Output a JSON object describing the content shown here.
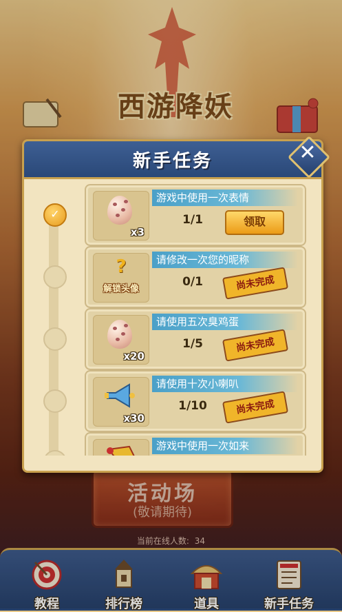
{
  "header_logo": "西游降妖",
  "modal": {
    "title": "新手任务",
    "close_label": "✕"
  },
  "tasks": [
    {
      "name": "游戏中使用一次表情",
      "progress": "1/1",
      "reward_icon": "egg-icon",
      "reward_qty": "x3",
      "status": "领取",
      "state": "claimable"
    },
    {
      "name": "请修改一次您的昵称",
      "progress": "0/1",
      "reward_icon": "unlock-avatar-icon",
      "reward_label": "解锁头像",
      "status": "尚未完成",
      "state": "incomplete"
    },
    {
      "name": "请使用五次臭鸡蛋",
      "progress": "1/5",
      "reward_icon": "egg-icon",
      "reward_qty": "x20",
      "status": "尚未完成",
      "state": "incomplete"
    },
    {
      "name": "请使用十次小喇叭",
      "progress": "1/10",
      "reward_icon": "horn-icon",
      "reward_qty": "x30",
      "status": "尚未完成",
      "state": "incomplete"
    },
    {
      "name": "游戏中使用一次如来",
      "reward_icon": "flag-icon"
    }
  ],
  "activity": {
    "title": "活动场",
    "subtitle": "(敬请期待)"
  },
  "online": {
    "label": "当前在线人数:",
    "count": "34"
  },
  "bottom_nav": [
    {
      "label": "教程",
      "icon": "target-icon"
    },
    {
      "label": "排行榜",
      "icon": "trophy-icon"
    },
    {
      "label": "道具",
      "icon": "shop-icon"
    },
    {
      "label": "新手任务",
      "icon": "task-icon"
    }
  ],
  "colors": {
    "header_blue": "#2a4878",
    "gold_border": "#c9a14e",
    "panel_bg": "#f2e4c0",
    "claim_gold": "#eb9b17",
    "task_name_bg": "#4aa0c8"
  }
}
